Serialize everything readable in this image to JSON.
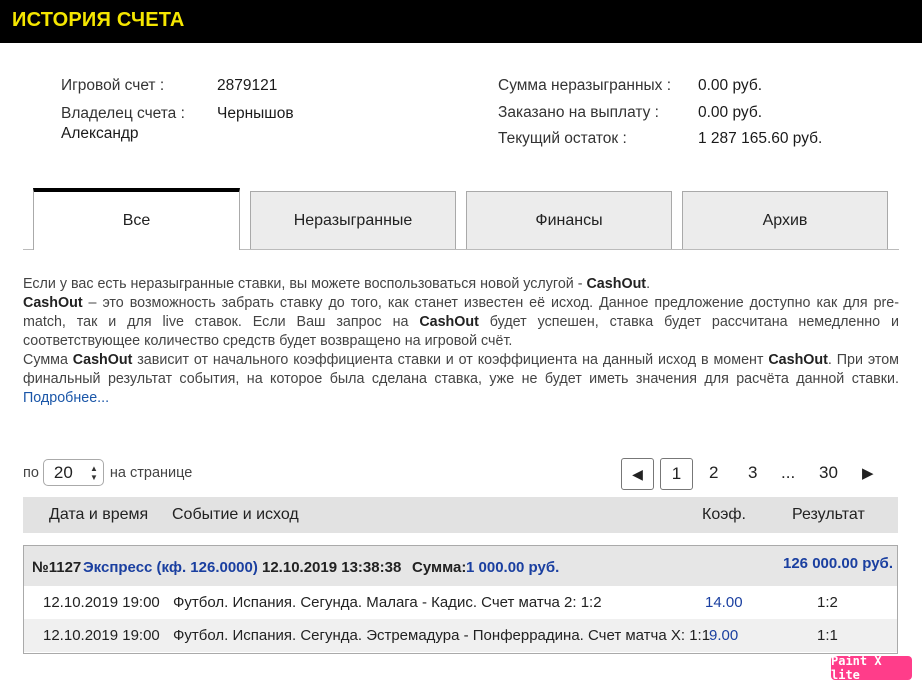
{
  "header": {
    "title": "ИСТОРИЯ СЧЕТА"
  },
  "account": {
    "game_account_label": "Игровой счет :",
    "game_account_value": "2879121",
    "owner_label": "Владелец счета :",
    "owner_first_name": "Александр",
    "owner_last_name": "Чернышов",
    "unplayed_label": "Сумма неразыгранных :",
    "unplayed_value": "0.00 руб.",
    "ordered_label": "Заказано на выплату :",
    "ordered_value": "0.00 руб.",
    "balance_label": "Текущий остаток :",
    "balance_value": "1 287 165.60 руб."
  },
  "tabs": [
    {
      "label": "Все",
      "active": true
    },
    {
      "label": "Неразыгранные",
      "active": false
    },
    {
      "label": "Финансы",
      "active": false
    },
    {
      "label": "Архив",
      "active": false
    }
  ],
  "description": {
    "p1_text": "Если у вас есть неразыгранные ставки, вы можете воспользоваться новой услугой - ",
    "p1_bold": "CashOut",
    "p1_end": ".",
    "p2_bold": "CashOut",
    "p2_text_a": " – это возможность забрать ставку до того, как станет известен её исход. Данное предложение доступно как для pre-match, так и для live ставок. Если Ваш запрос на ",
    "p2_bold_b": "CashOut",
    "p2_text_b": " будет успешен, ставка будет рассчитана немедленно и соответствующее количество средств будет возвращено на игровой счёт.",
    "p3_text_a": "Сумма ",
    "p3_bold_a": "CashOut",
    "p3_text_b": " зависит от начального коэффициента ставки и от коэффициента на данный исход в момент ",
    "p3_bold_b": "CashOut",
    "p3_text_c": ". При этом финальный результат события, на которое была сделана ставка, уже не будет иметь значения для расчёта данной ставки. ",
    "more_link": "Подробнее..."
  },
  "per_page": {
    "prefix": "по",
    "value": "20",
    "suffix": "на странице"
  },
  "pagination": {
    "prev": "◀",
    "current": "1",
    "p2": "2",
    "p3": "3",
    "ellipsis": "...",
    "last": "30",
    "next": "▶"
  },
  "table": {
    "col_datetime": "Дата и время",
    "col_event": "Событие и исход",
    "col_coef": "Коэф.",
    "col_result": "Результат"
  },
  "bet": {
    "number": "№1127",
    "type": "Экспресс (кф. 126.0000)",
    "datetime": "12.10.2019 13:38:38",
    "sum_label": "Сумма:",
    "sum_value": "1 000.00 руб.",
    "payout": "126 000.00 руб.",
    "rows": [
      {
        "datetime": "12.10.2019 19:00",
        "event": "Футбол. Испания. Сегунда. Малага - Кадис. Счет матча 2: 1:2",
        "coef": "14.00",
        "result": "1:2"
      },
      {
        "datetime": "12.10.2019 19:00",
        "event": "Футбол. Испания. Сегунда. Эстремадура - Понферрадина. Счет матча Х: 1:1",
        "coef": "9.00",
        "result": "1:1"
      }
    ]
  },
  "watermark": {
    "text": "Paint X lite"
  }
}
